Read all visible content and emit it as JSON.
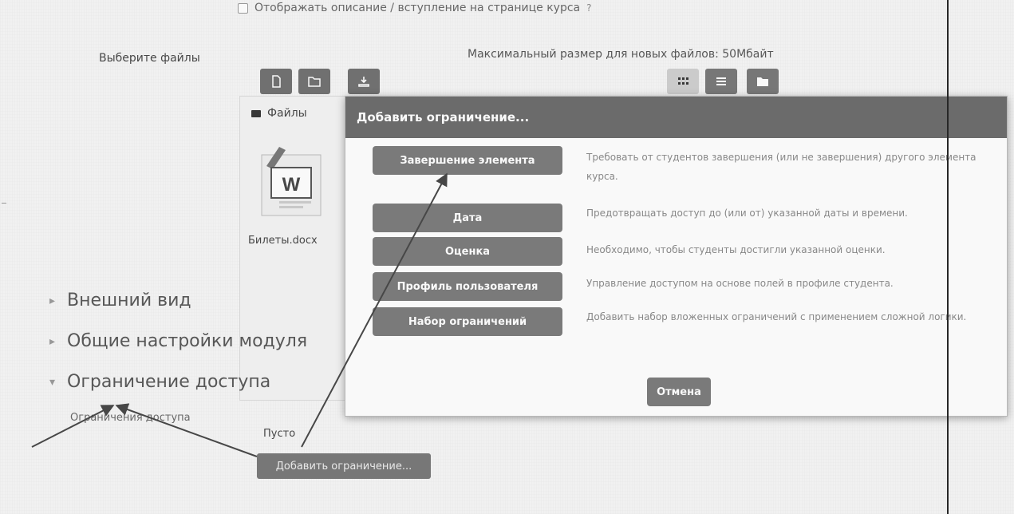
{
  "header_note": {
    "text": "Отображать описание / вступление на странице курса",
    "help_icon": "question-icon"
  },
  "filepicker": {
    "label": "Выберите файлы",
    "max_size": "Максимальный размер для новых файлов: 50Мбайт",
    "toolbar": [
      "add-file-icon",
      "create-folder-icon",
      "download-icon"
    ],
    "views": [
      "grid-view-icon",
      "list-view-icon",
      "tree-view-icon"
    ],
    "breadcrumb": "Файлы",
    "file": {
      "name": "Билеты.docx",
      "icon": "word-document-icon"
    }
  },
  "sections": [
    {
      "label": "Внешний вид",
      "state": "collapsed"
    },
    {
      "label": "Общие настройки модуля",
      "state": "collapsed"
    },
    {
      "label": "Ограничение доступа",
      "state": "expanded"
    }
  ],
  "restriction": {
    "label": "Ограничения доступа",
    "empty": "Пусто",
    "add_button": "Добавить ограничение..."
  },
  "modal": {
    "title": "Добавить ограничение...",
    "options": [
      {
        "label": "Завершение элемента",
        "description": "Требовать от студентов завершения (или не завершения) другого элемента курса."
      },
      {
        "label": "Дата",
        "description": "Предотвращать доступ до (или от) указанной даты и времени."
      },
      {
        "label": "Оценка",
        "description": "Необходимо, чтобы студенты достигли указанной оценки."
      },
      {
        "label": "Профиль пользователя",
        "description": "Управление доступом на основе полей в профиле студента."
      },
      {
        "label": "Набор ограничений",
        "description": "Добавить набор вложенных ограничений с применением сложной логики."
      }
    ],
    "cancel": "Отмена"
  },
  "annotations": {
    "arrow_color": "#4a4a4a"
  }
}
